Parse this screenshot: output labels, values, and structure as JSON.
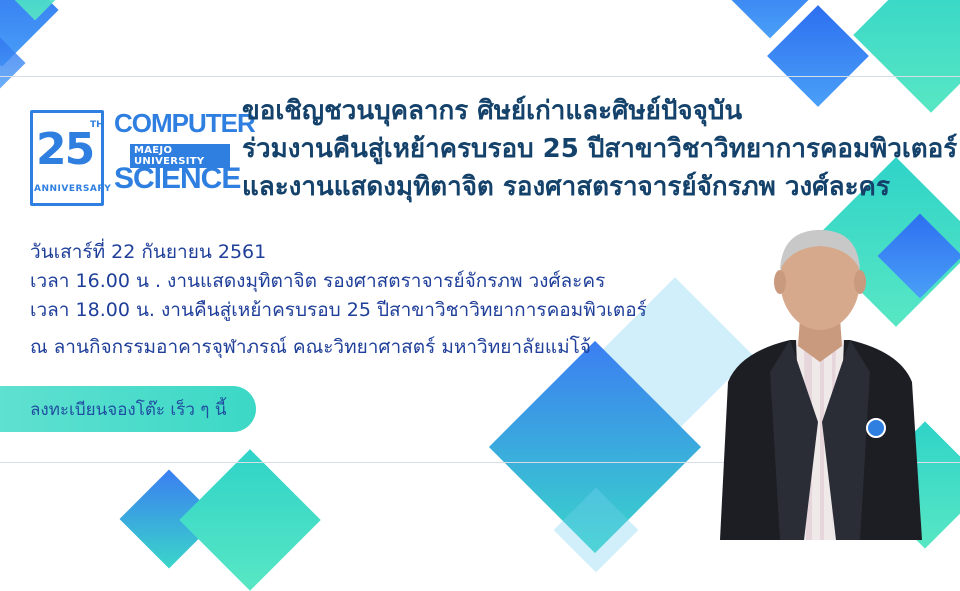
{
  "logo": {
    "number": "25",
    "ordinal": "TH",
    "anniversary": "ANNIVERSARY",
    "computer": "COMPUTER",
    "university": "MAEJO UNIVERSITY",
    "science": "SCIENCE"
  },
  "headline": [
    "ขอเชิญชวนบุคลากร ศิษย์เก่าและศิษย์ปัจจุบัน",
    "ร่วมงานคืนสู่เหย้าครบรอบ 25 ปีสาขาวิชาวิทยาการคอมพิวเตอร์",
    "และงานแสดงมุทิตาจิต รองศาสตราจารย์จักรภพ วงศ์ละคร"
  ],
  "details": {
    "date": "วันเสาร์ที่ 22 กันยายน 2561",
    "time1": "เวลา 16.00 น .  งานแสดงมุทิตาจิต รองศาสตราจารย์จักรภพ วงศ์ละคร",
    "time2": "เวลา 18.00 น.   งานคืนสู่เหย้าครบรอบ 25 ปีสาขาวิชาวิทยาการคอมพิวเตอร์",
    "venue": "ณ ลานกิจกรรมอาคารจุฬาภรณ์  คณะวิทยาศาสตร์ มหาวิทยาลัยแม่โจ้"
  },
  "register": "ลงทะเบียนจองโต๊ะ เร็ว ๆ นี้",
  "colors": {
    "headline": "#15426b",
    "details": "#1f3f9a",
    "brand_blue": "#2f7fe0",
    "teal": "#3cd8c6"
  }
}
